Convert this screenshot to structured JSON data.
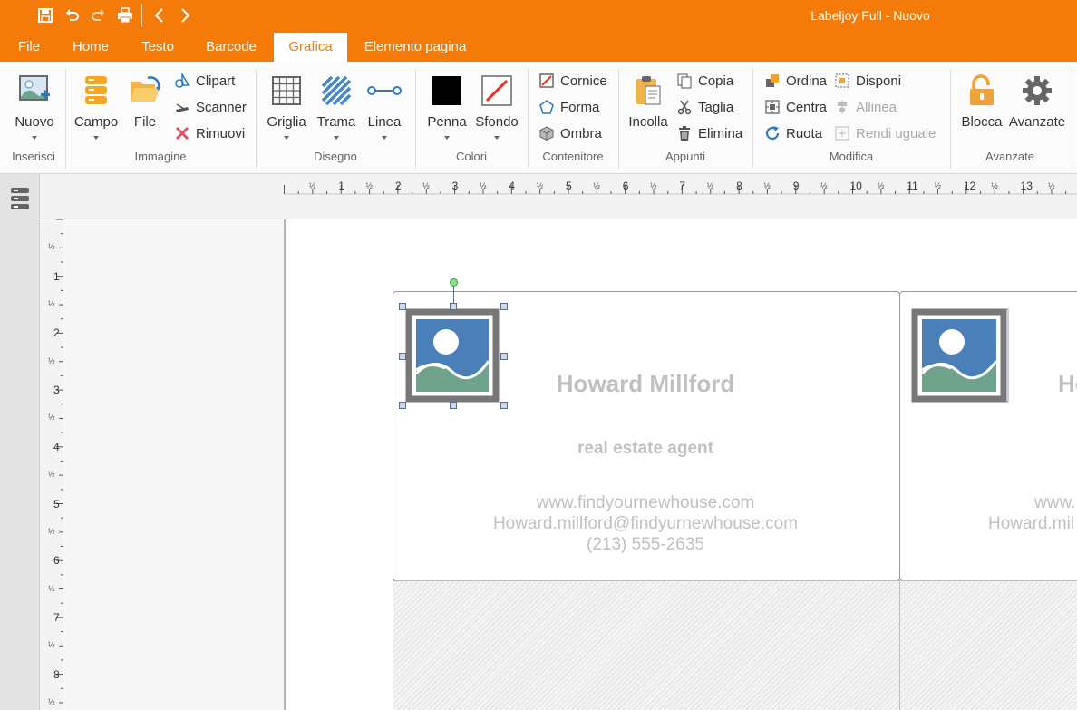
{
  "window": {
    "title": "Labeljoy Full - Nuovo"
  },
  "quick_access": [
    "save-icon",
    "undo-icon",
    "redo-icon",
    "print-icon",
    "back-icon",
    "forward-icon"
  ],
  "menu": {
    "tabs": [
      "File",
      "Home",
      "Testo",
      "Barcode",
      "Grafica",
      "Elemento pagina"
    ],
    "active_tab": "Grafica"
  },
  "ribbon": {
    "inserisci": {
      "label": "Inserisci",
      "nuovo": "Nuovo"
    },
    "immagine": {
      "label": "Immagine",
      "campo": "Campo",
      "file": "File",
      "clipart": "Clipart",
      "scanner": "Scanner",
      "rimuovi": "Rimuovi"
    },
    "disegno": {
      "label": "Disegno",
      "griglia": "Griglia",
      "trama": "Trama",
      "linea": "Linea"
    },
    "colori": {
      "label": "Colori",
      "penna": "Penna",
      "sfondo": "Sfondo"
    },
    "contenitore": {
      "label": "Contenitore",
      "cornice": "Cornice",
      "forma": "Forma",
      "ombra": "Ombra"
    },
    "appunti": {
      "label": "Appunti",
      "incolla": "Incolla",
      "copia": "Copia",
      "taglia": "Taglia",
      "elimina": "Elimina"
    },
    "modifica": {
      "label": "Modifica",
      "ordina": "Ordina",
      "centra": "Centra",
      "ruota": "Ruota",
      "disponi": "Disponi",
      "allinea": "Allinea",
      "rendi_uguale": "Rendi uguale"
    },
    "avanzate": {
      "label": "Avanzate",
      "blocca": "Blocca",
      "avanzate": "Avanzate"
    }
  },
  "ruler": {
    "half": "½",
    "horizontal_numbers": [
      "1",
      "2",
      "3",
      "4",
      "5",
      "6",
      "7",
      "8",
      "9",
      "10",
      "11",
      "12",
      "13"
    ],
    "vertical_numbers": [
      "1",
      "2",
      "3",
      "4",
      "5",
      "6",
      "7",
      "8"
    ]
  },
  "label1": {
    "name": "Howard Millford",
    "job": "real estate agent",
    "web": "www.findyournewhouse.com",
    "email": "Howard.millford@findyurnewhouse.com",
    "phone": "(213) 555-2635"
  },
  "label2": {
    "name": "Ho",
    "web": "www.",
    "email": "Howard.mil"
  },
  "colors": {
    "accent": "#f47a0a",
    "pen": "#000000",
    "background_swatch": "#e8301c",
    "label_text": "#c0c0c0"
  }
}
